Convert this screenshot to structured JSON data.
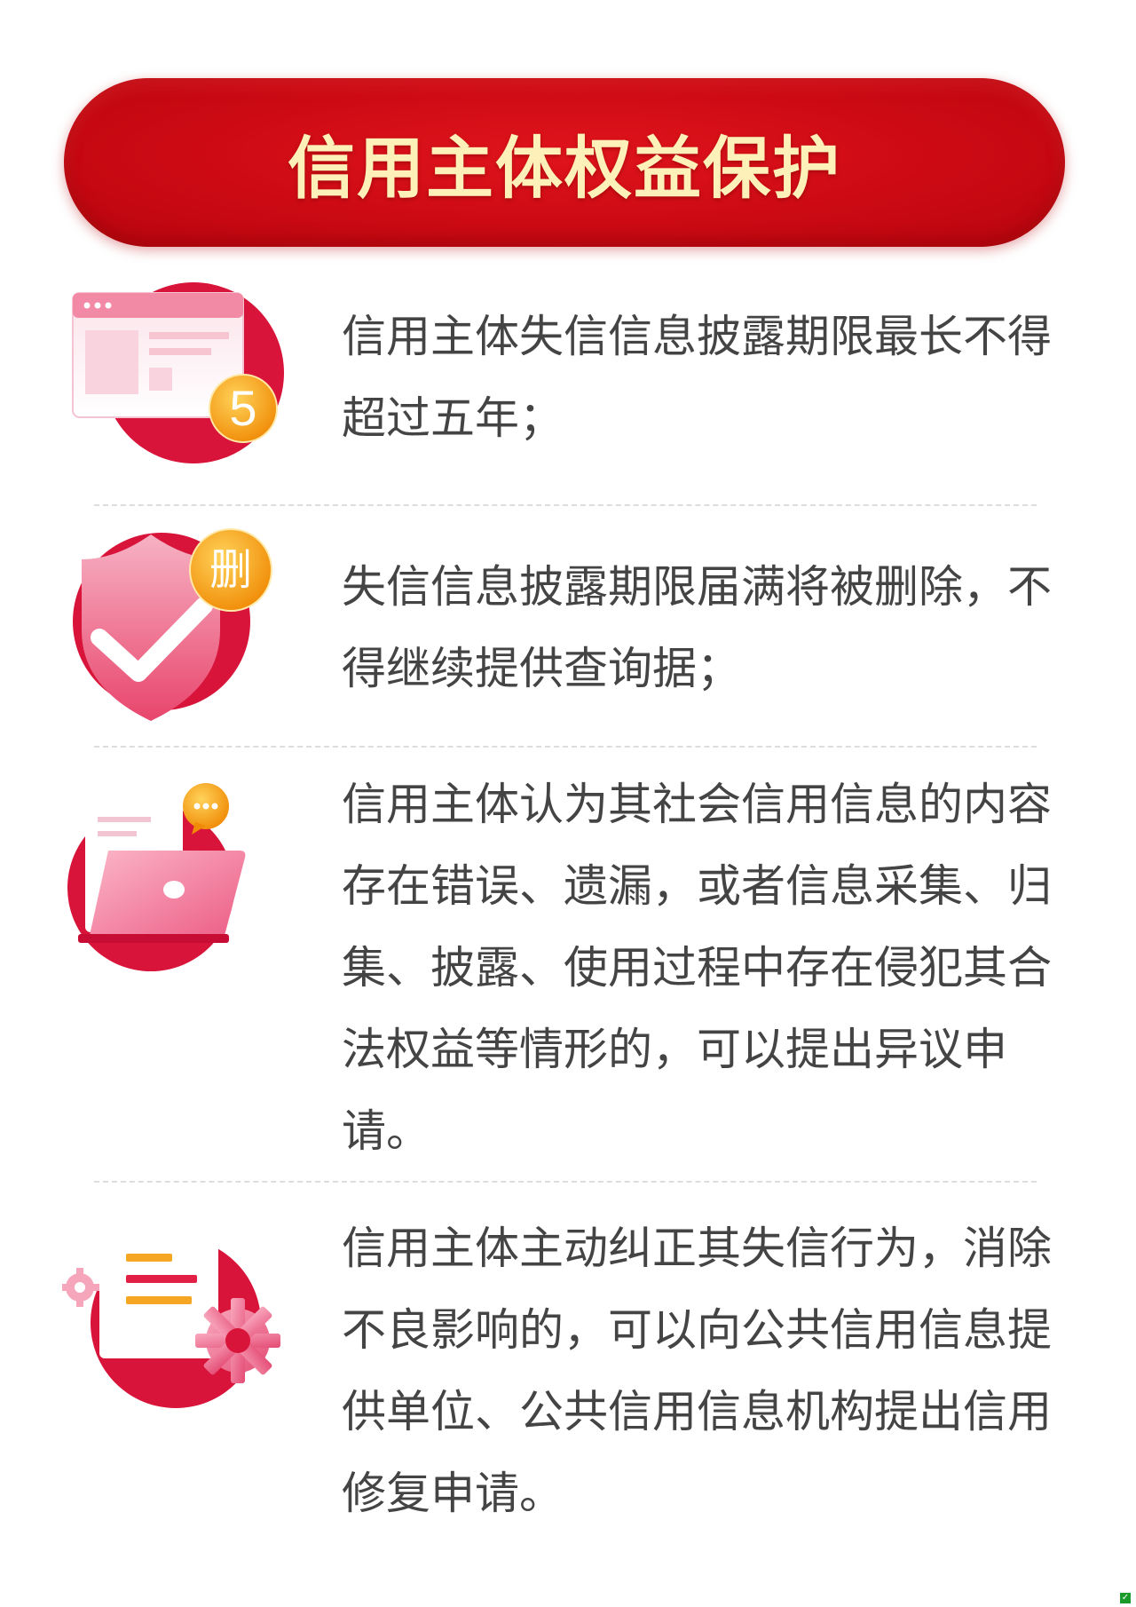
{
  "banner": {
    "title": "信用主体权益保护"
  },
  "items": [
    {
      "icon": "browser-window-5-icon",
      "badge": "5",
      "text": "信用主体失信信息披露期限最长不得超过五年；"
    },
    {
      "icon": "shield-check-delete-icon",
      "badge": "删",
      "text": "失信信息披露期限届满将被删除，不得继续提供查询据；"
    },
    {
      "icon": "laptop-chat-icon",
      "text": "信用主体认为其社会信用信息的内容存在错误、遗漏，或者信息采集、归集、披露、使用过程中存在侵犯其合法权益等情形的，可以提出异议申请。"
    },
    {
      "icon": "document-gear-icon",
      "text": "信用主体主动纠正其失信行为，消除不良影响的，可以向公共信用信息提供单位、公共信用信息机构提出信用修复申请。"
    }
  ],
  "colors": {
    "banner_red": "#cc0a14",
    "banner_text": "#fdf0b8",
    "icon_red": "#d9143a",
    "icon_pink": "#f7a8bd",
    "badge_orange": "#f59a0c",
    "body_text": "#444444"
  }
}
